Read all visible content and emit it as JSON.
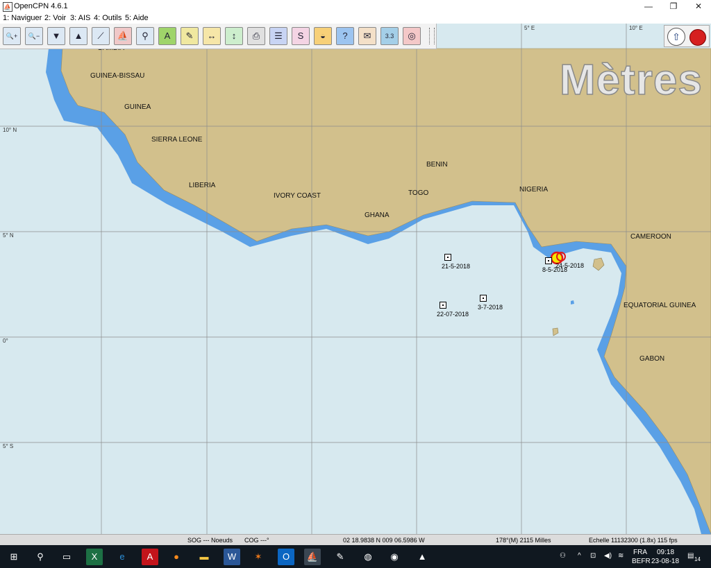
{
  "window": {
    "title": "OpenCPN 4.6.1",
    "minimize": "—",
    "maximize": "❐",
    "close": "✕"
  },
  "menu": [
    "1: Naviguer",
    "2: Voir",
    "3: AIS",
    "4: Outils",
    "5: Aide"
  ],
  "toolbar": [
    {
      "name": "zoom-in-icon",
      "glyph": "🔍+",
      "color": "#dce8f4"
    },
    {
      "name": "zoom-out-icon",
      "glyph": "🔍−",
      "color": "#dce8f4"
    },
    {
      "name": "scale-in-icon",
      "glyph": "▼",
      "color": "#dce8f4"
    },
    {
      "name": "scale-out-icon",
      "glyph": "▲",
      "color": "#dce8f4"
    },
    {
      "name": "route-icon",
      "glyph": "⟋",
      "color": "#dce8f4"
    },
    {
      "name": "ship-icon",
      "glyph": "⛵",
      "color": "#f0c8c8"
    },
    {
      "name": "follow-icon",
      "glyph": "⚲",
      "color": "#dce8f4"
    },
    {
      "name": "text-icon",
      "glyph": "A",
      "color": "#9fd46a"
    },
    {
      "name": "pencil-icon",
      "glyph": "✎",
      "color": "#f0e8a0"
    },
    {
      "name": "chart-bar-icon",
      "glyph": "↔",
      "color": "#f6e6a8"
    },
    {
      "name": "tide-icon",
      "glyph": "↕",
      "color": "#cdeecd"
    },
    {
      "name": "print-icon",
      "glyph": "⎙",
      "color": "#e0e0e0"
    },
    {
      "name": "route-manager-icon",
      "glyph": "☰",
      "color": "#c8d4f4"
    },
    {
      "name": "track-icon",
      "glyph": "S",
      "color": "#f4d4e4"
    },
    {
      "name": "color-scheme-icon",
      "glyph": "◒",
      "color": "#f7d078"
    },
    {
      "name": "help-icon",
      "glyph": "?",
      "color": "#9cc4f0"
    },
    {
      "name": "mob-settings-icon",
      "glyph": "✉",
      "color": "#f4e0c8"
    },
    {
      "name": "measure-icon",
      "glyph": "3.3",
      "color": "#a4cfe8"
    },
    {
      "name": "lifebuoy-icon",
      "glyph": "◎",
      "color": "#f4c8c8"
    }
  ],
  "chart": {
    "depth_unit": "Mètres",
    "countries": [
      {
        "name": "GAMBIA",
        "id": "gambia"
      },
      {
        "name": "GUINEA-BISSAU",
        "id": "guinea-bissau"
      },
      {
        "name": "GUINEA",
        "id": "guinea"
      },
      {
        "name": "SIERRA LEONE",
        "id": "sierra-leone"
      },
      {
        "name": "LIBERIA",
        "id": "liberia"
      },
      {
        "name": "IVORY COAST",
        "id": "ivory-coast"
      },
      {
        "name": "GHANA",
        "id": "ghana"
      },
      {
        "name": "TOGO",
        "id": "togo"
      },
      {
        "name": "BENIN",
        "id": "benin"
      },
      {
        "name": "NIGERIA",
        "id": "nigeria"
      },
      {
        "name": "CAMEROON",
        "id": "cameroon"
      },
      {
        "name": "EQUATORIAL GUINEA",
        "id": "equatorial-guinea"
      },
      {
        "name": "GABON",
        "id": "gabon"
      }
    ],
    "lat_labels": [
      "10° N",
      "5° N",
      "0°",
      "5° S"
    ],
    "lon_labels": [
      "5° E",
      "10° E"
    ],
    "waypoints": [
      {
        "label": "21-5-2018"
      },
      {
        "label": "3-7-2018"
      },
      {
        "label": "22-07-2018"
      },
      {
        "label": "8-5-2018"
      },
      {
        "label": "24-5-2018"
      }
    ]
  },
  "status": {
    "sog": "SOG --- Noeuds",
    "cog": "COG ---°",
    "position": "02 18.9838 N   009 06.5986 W",
    "bearing_dist": "178°(M)  2115 Milles",
    "scale": "Echelle 11132300 (1.8x)  115 fps"
  },
  "taskbar": {
    "language": "FRA",
    "keyboard": "BEFR",
    "time": "09:18",
    "date": "23-08-18",
    "notifications": "14"
  }
}
